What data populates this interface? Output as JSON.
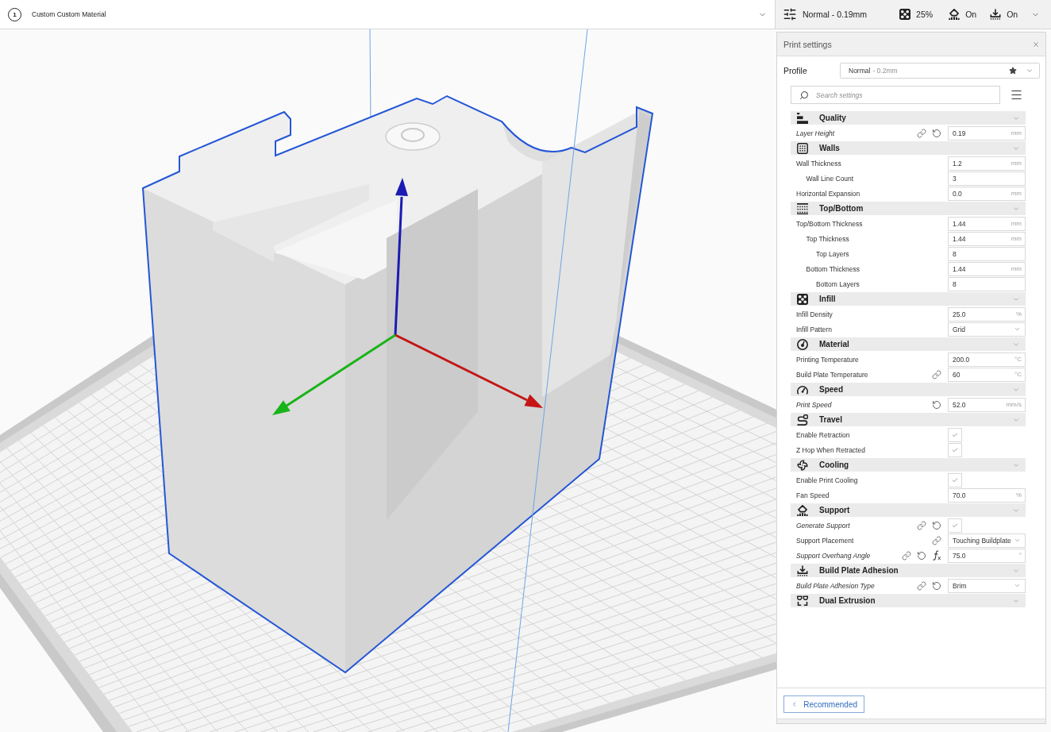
{
  "top_bar": {
    "extruder": {
      "number": "1",
      "material": "Custom Custom Material"
    },
    "print_setup": {
      "profile": "Normal - 0.19mm",
      "infill": "25%",
      "support": "On",
      "adhesion": "On"
    }
  },
  "print_settings": {
    "title": "Print settings",
    "profile": {
      "label": "Profile",
      "name": "Normal",
      "detail": "- 0.2mm"
    },
    "search": {
      "placeholder": "Search settings"
    },
    "categories": [
      {
        "title": "Quality",
        "settings": [
          {
            "label": "Layer Height",
            "modified": true,
            "indicators": [
              {
                "kind": "link"
              },
              {
                "kind": "reset"
              }
            ],
            "control": {
              "kind": "number",
              "value": "0.19",
              "unit": "mm"
            }
          }
        ]
      },
      {
        "title": "Walls",
        "settings": [
          {
            "label": "Wall Thickness",
            "modified": false,
            "control": {
              "kind": "number",
              "value": "1.2",
              "unit": "mm"
            },
            "children": [
              {
                "label": "Wall Line Count",
                "modified": false,
                "control": {
                  "kind": "number",
                  "value": "3"
                }
              }
            ]
          },
          {
            "label": "Horizontal Expansion",
            "modified": false,
            "control": {
              "kind": "number",
              "value": "0.0",
              "unit": "mm"
            }
          }
        ]
      },
      {
        "title": "Top/Bottom",
        "settings": [
          {
            "label": "Top/Bottom Thickness",
            "modified": false,
            "control": {
              "kind": "number",
              "value": "1.44",
              "unit": "mm"
            },
            "children": [
              {
                "label": "Top Thickness",
                "modified": false,
                "control": {
                  "kind": "number",
                  "value": "1.44",
                  "unit": "mm"
                },
                "children": [
                  {
                    "label": "Top Layers",
                    "modified": false,
                    "control": {
                      "kind": "number",
                      "value": "8"
                    }
                  }
                ]
              },
              {
                "label": "Bottom Thickness",
                "modified": false,
                "control": {
                  "kind": "number",
                  "value": "1.44",
                  "unit": "mm"
                },
                "children": [
                  {
                    "label": "Bottom Layers",
                    "modified": false,
                    "control": {
                      "kind": "number",
                      "value": "8"
                    }
                  }
                ]
              }
            ]
          }
        ]
      },
      {
        "title": "Infill",
        "settings": [
          {
            "label": "Infill Density",
            "modified": false,
            "control": {
              "kind": "number",
              "value": "25.0",
              "unit": "%"
            }
          },
          {
            "label": "Infill Pattern",
            "modified": false,
            "control": {
              "kind": "select",
              "value": "Grid"
            }
          }
        ]
      },
      {
        "title": "Material",
        "settings": [
          {
            "label": "Printing Temperature",
            "modified": false,
            "control": {
              "kind": "number",
              "value": "200.0",
              "unit": "°C"
            }
          },
          {
            "label": "Build Plate Temperature",
            "modified": false,
            "indicators": [
              {
                "kind": "link"
              }
            ],
            "control": {
              "kind": "number",
              "value": "60",
              "unit": "°C"
            }
          }
        ]
      },
      {
        "title": "Speed",
        "settings": [
          {
            "label": "Print Speed",
            "modified": true,
            "indicators": [
              {
                "kind": "reset"
              }
            ],
            "control": {
              "kind": "number",
              "value": "52.0",
              "unit": "mm/s"
            }
          }
        ]
      },
      {
        "title": "Travel",
        "settings": [
          {
            "label": "Enable Retraction",
            "modified": false,
            "control": {
              "kind": "checkbox",
              "checked": true
            }
          },
          {
            "label": "Z Hop When Retracted",
            "modified": false,
            "control": {
              "kind": "checkbox",
              "checked": true
            }
          }
        ]
      },
      {
        "title": "Cooling",
        "settings": [
          {
            "label": "Enable Print Cooling",
            "modified": false,
            "control": {
              "kind": "checkbox",
              "checked": true
            }
          },
          {
            "label": "Fan Speed",
            "modified": false,
            "control": {
              "kind": "number",
              "value": "70.0",
              "unit": "%"
            }
          }
        ]
      },
      {
        "title": "Support",
        "settings": [
          {
            "label": "Generate Support",
            "modified": true,
            "indicators": [
              {
                "kind": "link"
              },
              {
                "kind": "reset"
              }
            ],
            "control": {
              "kind": "checkbox",
              "checked": true
            }
          },
          {
            "label": "Support Placement",
            "modified": false,
            "indicators": [
              {
                "kind": "link"
              }
            ],
            "control": {
              "kind": "select",
              "value": "Touching Buildplate"
            }
          },
          {
            "label": "Support Overhang Angle",
            "modified": true,
            "indicators": [
              {
                "kind": "link"
              },
              {
                "kind": "reset"
              },
              {
                "kind": "function"
              }
            ],
            "control": {
              "kind": "number",
              "value": "75.0",
              "unit": "°"
            }
          }
        ]
      },
      {
        "title": "Build Plate Adhesion",
        "settings": [
          {
            "label": "Build Plate Adhesion Type",
            "modified": true,
            "indicators": [
              {
                "kind": "link"
              },
              {
                "kind": "reset"
              }
            ],
            "control": {
              "kind": "select",
              "value": "Brim"
            }
          }
        ]
      },
      {
        "title": "Dual Extrusion"
      }
    ],
    "footer": {
      "button": "Recommended"
    }
  }
}
